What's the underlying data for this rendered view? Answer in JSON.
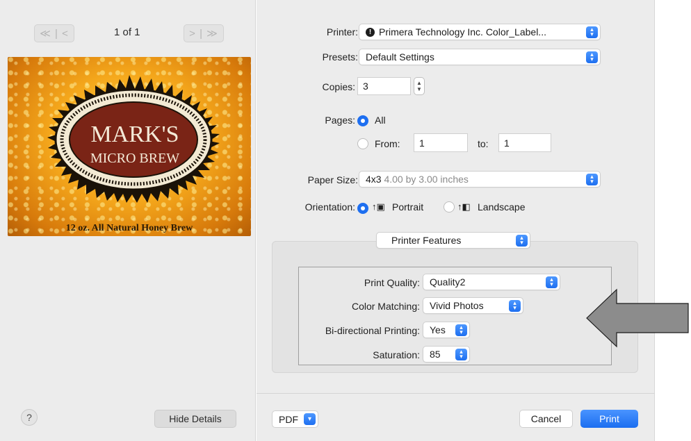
{
  "preview": {
    "prev_label": "≪ | <",
    "page_indicator": "1 of 1",
    "next_label": "> | ≫",
    "label_title_line1": "MARK'S",
    "label_title_line2": "MICRO BREW",
    "label_tagline": "12 oz. All Natural Honey Brew",
    "help_label": "?",
    "hide_details_label": "Hide Details"
  },
  "printer": {
    "label": "Printer:",
    "value": "Primera Technology Inc. Color_Label..."
  },
  "presets": {
    "label": "Presets:",
    "value": "Default Settings"
  },
  "copies": {
    "label": "Copies:",
    "value": "3"
  },
  "pages": {
    "label": "Pages:",
    "all_label": "All",
    "from_label": "From:",
    "from_value": "1",
    "to_label": "to:",
    "to_value": "1"
  },
  "paper_size": {
    "label": "Paper Size:",
    "value_bold": "4x3",
    "value_detail": "4.00 by 3.00 inches"
  },
  "orientation": {
    "label": "Orientation:",
    "portrait_label": "Portrait",
    "landscape_label": "Landscape"
  },
  "features": {
    "section_select": "Printer Features",
    "print_quality_label": "Print Quality:",
    "print_quality_value": "Quality2",
    "color_matching_label": "Color Matching:",
    "color_matching_value": "Vivid Photos",
    "bidirectional_label": "Bi-directional Printing:",
    "bidirectional_value": "Yes",
    "saturation_label": "Saturation:",
    "saturation_value": "85"
  },
  "footer": {
    "pdf_label": "PDF",
    "cancel_label": "Cancel",
    "print_label": "Print"
  },
  "colors": {
    "accent": "#1e6ff0",
    "panel": "#ececec",
    "arrow_fill": "#8c8c8c"
  }
}
